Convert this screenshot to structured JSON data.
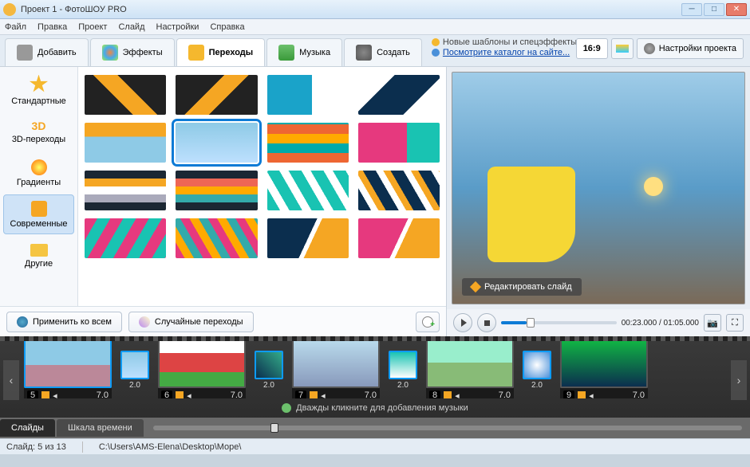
{
  "window": {
    "title": "Проект 1 - ФотоШОУ PRO"
  },
  "menu": [
    "Файл",
    "Правка",
    "Проект",
    "Слайд",
    "Настройки",
    "Справка"
  ],
  "tabs": {
    "add": "Добавить",
    "effects": "Эффекты",
    "transitions": "Переходы",
    "music": "Музыка",
    "create": "Создать",
    "active": "transitions"
  },
  "promo": {
    "line1": "Новые шаблоны и спецэффекты",
    "line2": "Посмотрите каталог на сайте..."
  },
  "rightTools": {
    "ratio": "16:9",
    "settings": "Настройки проекта"
  },
  "categories": [
    {
      "id": "standard",
      "label": "Стандартные"
    },
    {
      "id": "3d",
      "label": "3D-переходы"
    },
    {
      "id": "gradients",
      "label": "Градиенты"
    },
    {
      "id": "modern",
      "label": "Современные"
    },
    {
      "id": "other",
      "label": "Другие"
    }
  ],
  "activeCategory": "modern",
  "gridSelectedIndex": 5,
  "buttons": {
    "applyAll": "Применить ко всем",
    "random": "Случайные переходы"
  },
  "preview": {
    "editSlide": "Редактировать слайд",
    "time": "00:23.000 / 01:05.000"
  },
  "timeline": {
    "slides": [
      {
        "n": "5",
        "dur": "7.0"
      },
      {
        "n": "6",
        "dur": "7.0"
      },
      {
        "n": "7",
        "dur": "7.0"
      },
      {
        "n": "8",
        "dur": "7.0"
      },
      {
        "n": "9",
        "dur": "7.0"
      }
    ],
    "transDur": "2.0",
    "musicHint": "Дважды кликните для добавления музыки",
    "viewSlides": "Слайды",
    "viewTimeline": "Шкала времени"
  },
  "status": {
    "slide": "Слайд: 5 из 13",
    "path": "C:\\Users\\AMS-Elena\\Desktop\\Море\\"
  }
}
